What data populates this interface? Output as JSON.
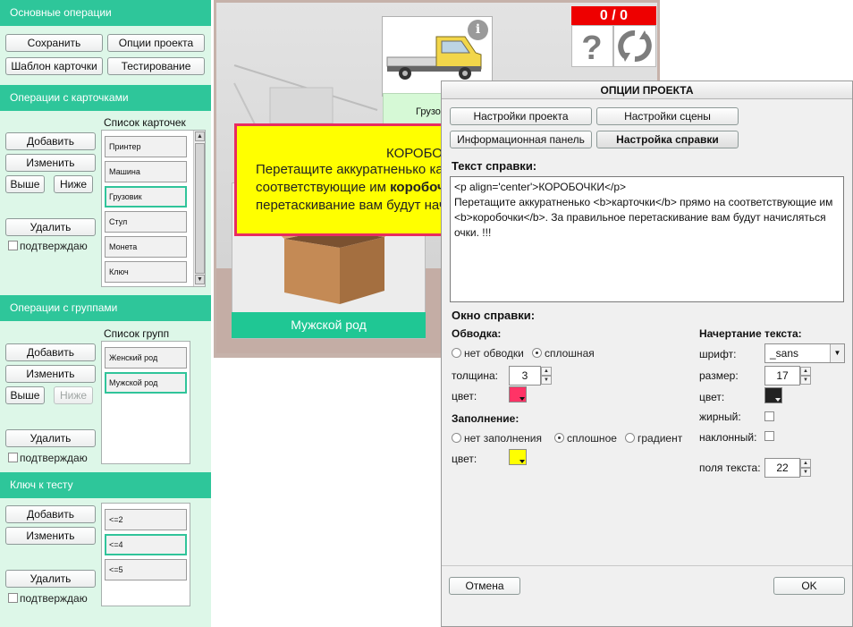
{
  "sidebar": {
    "basic_ops": {
      "header": "Основные операции",
      "save": "Сохранить",
      "project_options": "Опции проекта",
      "card_template": "Шаблон карточки",
      "testing": "Тестирование"
    },
    "card_ops": {
      "header": "Операции с карточками",
      "list_caption": "Список карточек",
      "add": "Добавить",
      "edit": "Изменить",
      "up": "Выше",
      "down": "Ниже",
      "delete": "Удалить",
      "confirm": "подтверждаю",
      "items": [
        "Принтер",
        "Машина",
        "Грузовик",
        "Стул",
        "Монета",
        "Ключ"
      ],
      "selected_index": 2
    },
    "group_ops": {
      "header": "Операции с группами",
      "list_caption": "Список групп",
      "add": "Добавить",
      "edit": "Изменить",
      "up": "Выше",
      "down": "Ниже",
      "delete": "Удалить",
      "confirm": "подтверждаю",
      "items": [
        "Женский род",
        "Мужской род"
      ],
      "selected_index": 1
    },
    "key_ops": {
      "header": "Ключ к тесту",
      "add": "Добавить",
      "edit": "Изменить",
      "delete": "Удалить",
      "confirm": "подтверждаю",
      "items": [
        "<=2",
        "<=4",
        "<=5"
      ],
      "selected_index": 1
    }
  },
  "stage": {
    "truck_caption": "Грузо",
    "box_label": "Мужской род",
    "score": "0 / 0",
    "help_popup": {
      "line1": "КОРОБОЧКИ",
      "line2": "Перетащите аккуратненько карточки прямо на",
      "line3a": "соответствующие им ",
      "line3b": "коробочки",
      "line4": "перетаскивание вам будут начисляться очки. !!!"
    }
  },
  "dialog": {
    "title": "ОПЦИИ ПРОЕКТА",
    "tabs": {
      "project_settings": "Настройки проекта",
      "scene_settings": "Настройки сцены",
      "info_panel": "Информационная панель",
      "help_settings": "Настройка справки"
    },
    "help_text_label": "Текст справки:",
    "help_text": "<p align='center'>КОРОБОЧКИ</p>\nПеретащите аккуратненько <b>карточки</b> прямо на соответствующие им <b>коробочки</b>. За правильное перетаскивание вам будут начисляться очки. !!!",
    "help_window_label": "Окно справки:",
    "border": {
      "label": "Обводка:",
      "none": "нет обводки",
      "solid": "сплошная",
      "thickness_label": "толщина:",
      "thickness": "3",
      "color_label": "цвет:",
      "color": "#ff3366"
    },
    "fill": {
      "label": "Заполнение:",
      "none": "нет заполнения",
      "solid": "сплошное",
      "gradient": "градиент",
      "color_label": "цвет:",
      "color": "#ffff00"
    },
    "text_style": {
      "label": "Начертание текста:",
      "font_label": "шрифт:",
      "font": "_sans",
      "size_label": "размер:",
      "size": "17",
      "color_label": "цвет:",
      "color": "#222222",
      "bold_label": "жирный:",
      "italic_label": "наклонный:",
      "padding_label": "поля текста:",
      "padding": "22"
    },
    "cancel": "Отмена",
    "ok": "OK"
  }
}
